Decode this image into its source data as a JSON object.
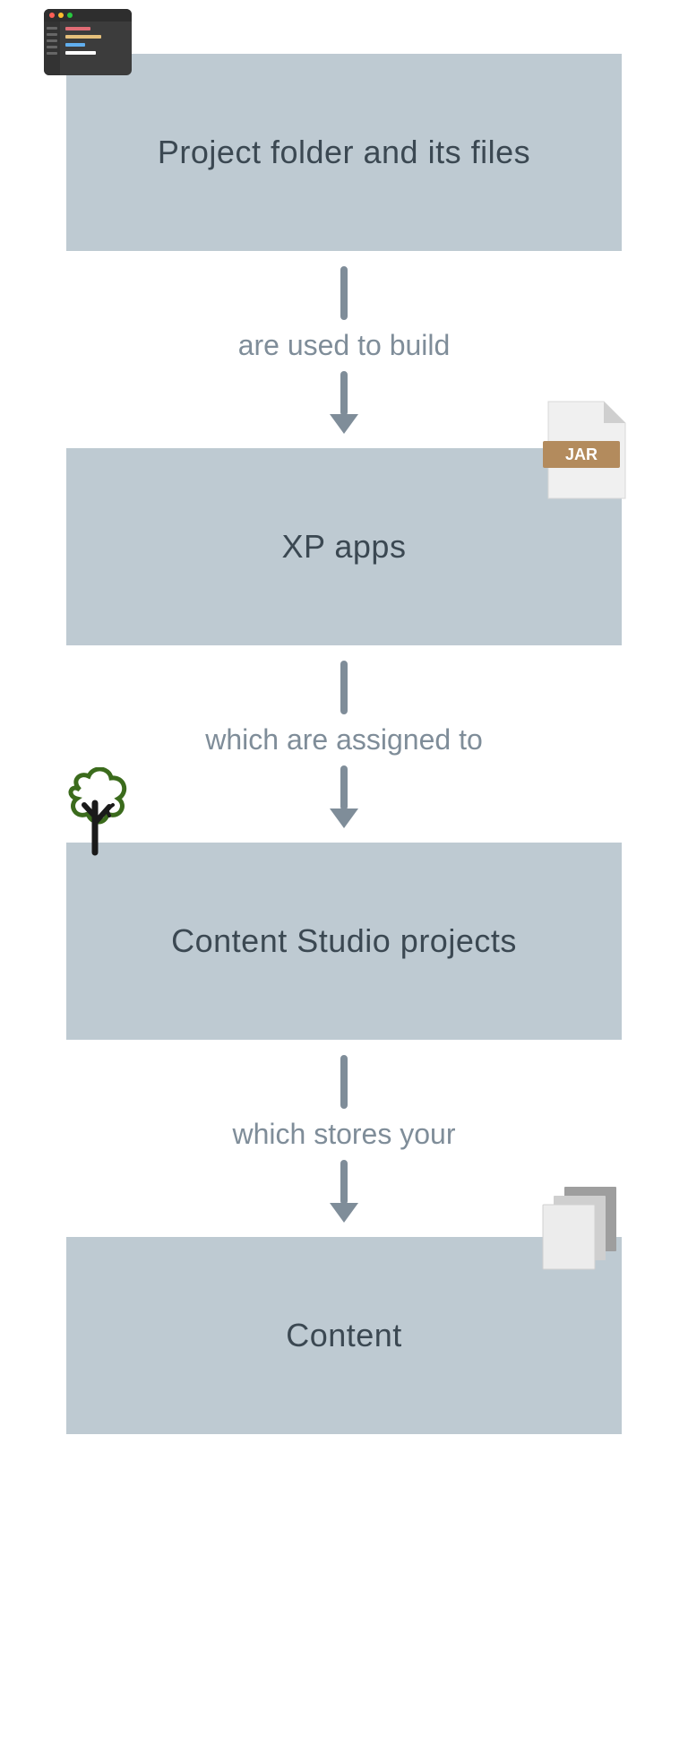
{
  "nodes": [
    {
      "label": "Project folder and its files"
    },
    {
      "label": "XP apps"
    },
    {
      "label": "Content Studio projects"
    },
    {
      "label": "Content"
    }
  ],
  "edges": [
    {
      "label": "are used to build"
    },
    {
      "label": "which are assigned to"
    },
    {
      "label": "which stores your"
    }
  ],
  "icons": {
    "code": "code-editor-icon",
    "jar": "jar-file-icon",
    "tree": "tree-icon",
    "docs": "documents-icon",
    "jar_label": "JAR"
  }
}
